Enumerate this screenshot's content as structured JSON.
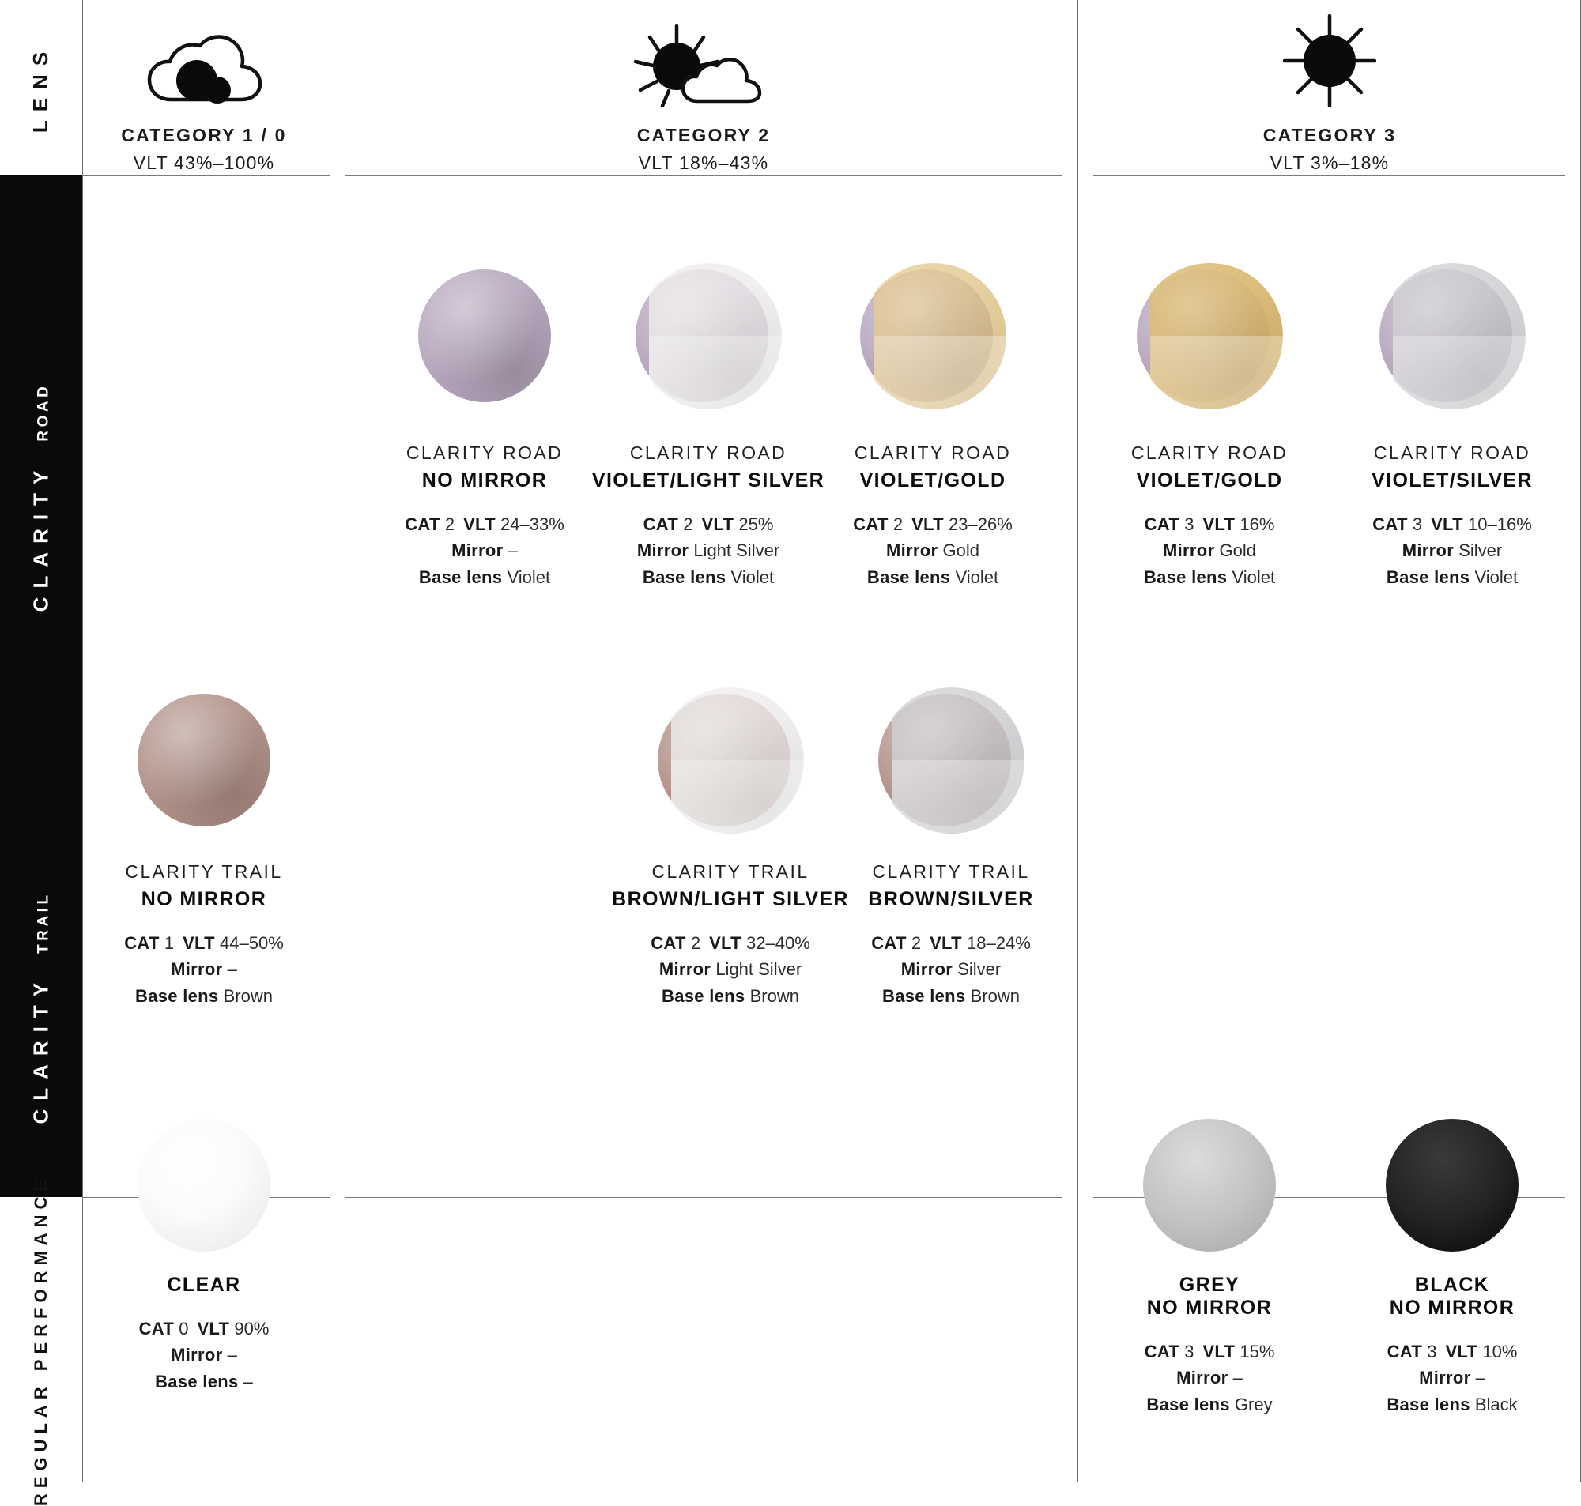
{
  "sidebar": {
    "rows": [
      {
        "id": "lens",
        "main": "LENS",
        "sub": "",
        "theme": "light"
      },
      {
        "id": "clarity-road",
        "main": "CLARITY",
        "sub": "ROAD",
        "theme": "dark"
      },
      {
        "id": "clarity-trail",
        "main": "CLARITY",
        "sub": "TRAIL",
        "theme": "dark"
      },
      {
        "id": "regular-performance",
        "main": "REGULAR PERFORMANCE",
        "sub": "",
        "theme": "light"
      }
    ]
  },
  "header": {
    "categories": [
      {
        "icon": "cloud-icon",
        "title": "CATEGORY 1 / 0",
        "vlt": "VLT 43%–100%"
      },
      {
        "icon": "sun-cloud-icon",
        "title": "CATEGORY 2",
        "vlt": "VLT 18%–43%"
      },
      {
        "icon": "sun-icon",
        "title": "CATEGORY 3",
        "vlt": "VLT 3%–18%"
      }
    ]
  },
  "labels": {
    "cat": "CAT",
    "vlt": "VLT",
    "mirror": "Mirror",
    "base_lens": "Base lens"
  },
  "colors": {
    "violet": "#b7a6bd",
    "brown": "#b19289",
    "gold": "#d8b366",
    "gold_light": "#e0c281",
    "silver": "#c9c9cd",
    "light_silver": "#eceaea",
    "grey": "#b9b9b9",
    "black": "#232323",
    "clear": "#f4f4f4",
    "rail_dark": "#0a0a0a",
    "rail_light": "#ffffff"
  },
  "rows": [
    {
      "id": "clarity-road",
      "cells": [
        {
          "col": 1,
          "brand": "CLARITY ROAD",
          "name": "NO MIRROR",
          "cat": "2",
          "vlt": "24–33%",
          "mirror": "–",
          "base_lens": "Violet",
          "swatch": {
            "base": "violet",
            "mirror": null
          }
        },
        {
          "col": 1,
          "brand": "CLARITY ROAD",
          "name": "VIOLET/LIGHT SILVER",
          "cat": "2",
          "vlt": "25%",
          "mirror": "Light Silver",
          "base_lens": "Violet",
          "swatch": {
            "base": "violet",
            "mirror": "light_silver"
          }
        },
        {
          "col": 1,
          "brand": "CLARITY ROAD",
          "name": "VIOLET/GOLD",
          "cat": "2",
          "vlt": "23–26%",
          "mirror": "Gold",
          "base_lens": "Violet",
          "swatch": {
            "base": "violet",
            "mirror": "gold_light"
          }
        },
        {
          "col": 2,
          "brand": "CLARITY ROAD",
          "name": "VIOLET/GOLD",
          "cat": "3",
          "vlt": "16%",
          "mirror": "Gold",
          "base_lens": "Violet",
          "swatch": {
            "base": "violet",
            "mirror": "gold"
          }
        },
        {
          "col": 2,
          "brand": "CLARITY ROAD",
          "name": "VIOLET/SILVER",
          "cat": "3",
          "vlt": "10–16%",
          "mirror": "Silver",
          "base_lens": "Violet",
          "swatch": {
            "base": "violet",
            "mirror": "silver"
          }
        }
      ]
    },
    {
      "id": "clarity-trail",
      "cells": [
        {
          "col": 0,
          "brand": "CLARITY TRAIL",
          "name": "NO MIRROR",
          "cat": "1",
          "vlt": "44–50%",
          "mirror": "–",
          "base_lens": "Brown",
          "swatch": {
            "base": "brown",
            "mirror": null
          }
        },
        {
          "col": 1,
          "brand": "CLARITY TRAIL",
          "name": "BROWN/LIGHT SILVER",
          "cat": "2",
          "vlt": "32–40%",
          "mirror": "Light Silver",
          "base_lens": "Brown",
          "swatch": {
            "base": "brown",
            "mirror": "light_silver"
          }
        },
        {
          "col": 1,
          "brand": "CLARITY TRAIL",
          "name": "BROWN/SILVER",
          "cat": "2",
          "vlt": "18–24%",
          "mirror": "Silver",
          "base_lens": "Brown",
          "swatch": {
            "base": "brown",
            "mirror": "silver"
          }
        }
      ]
    },
    {
      "id": "regular-performance",
      "cells": [
        {
          "col": 0,
          "brand": "",
          "name": "CLEAR",
          "cat": "0",
          "vlt": "90%",
          "mirror": "–",
          "base_lens": "–",
          "swatch": {
            "base": "clear",
            "mirror": null
          }
        },
        {
          "col": 2,
          "brand": "",
          "name": "GREY\nNO MIRROR",
          "cat": "3",
          "vlt": "15%",
          "mirror": "–",
          "base_lens": "Grey",
          "swatch": {
            "base": "grey",
            "mirror": null
          }
        },
        {
          "col": 2,
          "brand": "",
          "name": "BLACK\nNO MIRROR",
          "cat": "3",
          "vlt": "10%",
          "mirror": "–",
          "base_lens": "Black",
          "swatch": {
            "base": "black",
            "mirror": null
          }
        }
      ]
    }
  ]
}
